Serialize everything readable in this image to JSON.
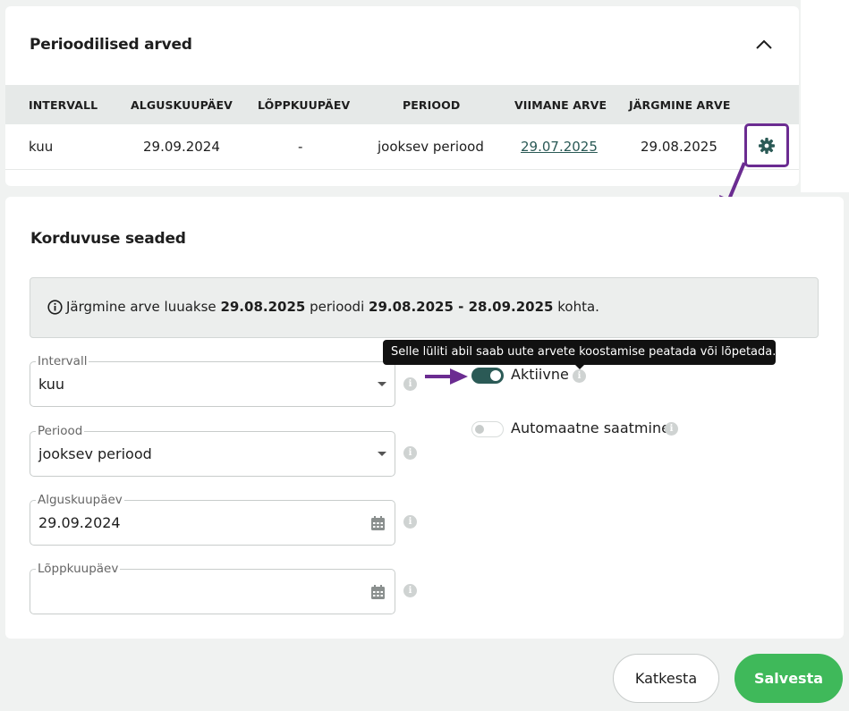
{
  "periodic_invoices": {
    "title": "Perioodilised arved",
    "columns": [
      "INTERVALL",
      "ALGUSKUUPÄEV",
      "LÕPPKUUPÄEV",
      "PERIOOD",
      "VIIMANE ARVE",
      "JÄRGMINE ARVE"
    ],
    "row": {
      "interval": "kuu",
      "start_date": "29.09.2024",
      "end_date": "-",
      "period": "jooksev periood",
      "last_invoice": "29.07.2025",
      "next_invoice": "29.08.2025"
    }
  },
  "settings": {
    "title": "Korduvuse seaded",
    "info": {
      "prefix": "Järgmine arve luuakse ",
      "date": "29.08.2025",
      "middle": " perioodi ",
      "range": "29.08.2025 - 28.09.2025",
      "suffix": " kohta."
    },
    "fields": {
      "interval": {
        "label": "Intervall",
        "value": "kuu"
      },
      "period": {
        "label": "Periood",
        "value": "jooksev periood"
      },
      "start_date": {
        "label": "Alguskuupäev",
        "value": "29.09.2024"
      },
      "end_date": {
        "label": "Lõppkuupäev",
        "value": ""
      }
    },
    "toggles": {
      "active": {
        "label": "Aktiivne",
        "on": true
      },
      "auto_send": {
        "label": "Automaatne saatmine",
        "on": false
      }
    },
    "tooltip": "Selle lüliti abil saab uute arvete koostamise peatada või lõpetada."
  },
  "actions": {
    "cancel": "Katkesta",
    "save": "Salvesta"
  },
  "colors": {
    "accent": "#2b5a56",
    "save": "#3fb95a",
    "highlight": "#6b2c91"
  }
}
